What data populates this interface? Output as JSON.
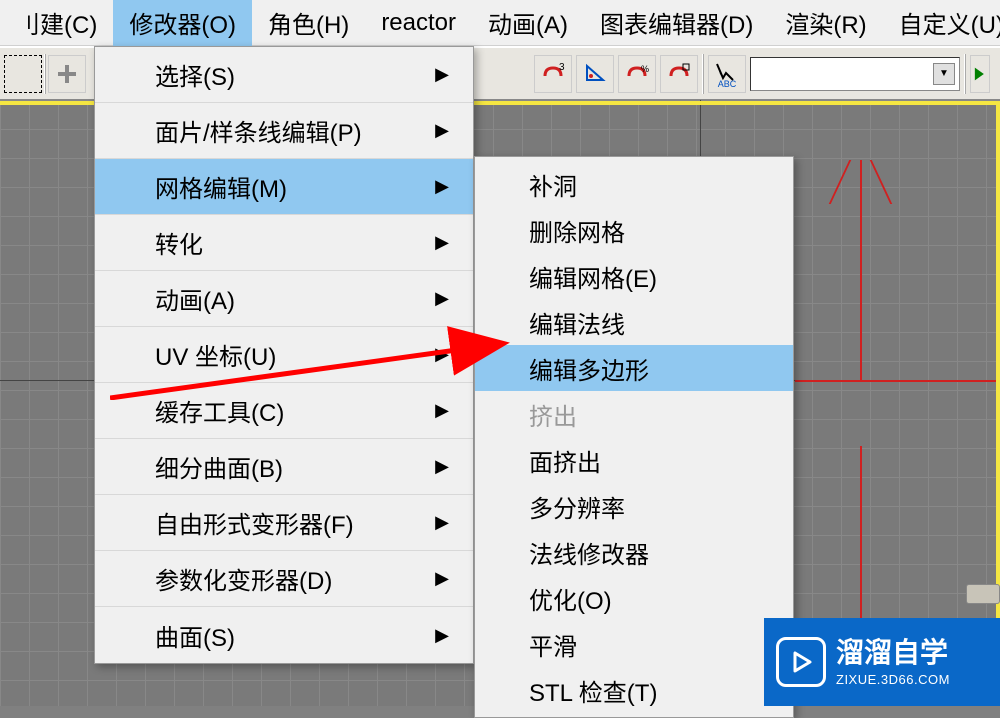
{
  "menubar": {
    "items": [
      {
        "label": "刂建(C)"
      },
      {
        "label": "修改器(O)",
        "active": true
      },
      {
        "label": "角色(H)"
      },
      {
        "label": "reactor"
      },
      {
        "label": "动画(A)"
      },
      {
        "label": "图表编辑器(D)"
      },
      {
        "label": "渲染(R)"
      },
      {
        "label": "自定义(U)"
      }
    ]
  },
  "dropdown": {
    "items": [
      {
        "label": "选择(S)"
      },
      {
        "label": "面片/样条线编辑(P)"
      },
      {
        "label": "网格编辑(M)",
        "active": true
      },
      {
        "label": "转化"
      },
      {
        "label": "动画(A)"
      },
      {
        "label": "UV 坐标(U)"
      },
      {
        "label": "缓存工具(C)"
      },
      {
        "label": "细分曲面(B)"
      },
      {
        "label": "自由形式变形器(F)"
      },
      {
        "label": "参数化变形器(D)"
      },
      {
        "label": "曲面(S)"
      }
    ]
  },
  "submenu": {
    "items": [
      {
        "label": "补洞"
      },
      {
        "label": "删除网格"
      },
      {
        "label": "编辑网格(E)"
      },
      {
        "label": "编辑法线"
      },
      {
        "label": "编辑多边形",
        "active": true
      },
      {
        "label": "挤出",
        "disabled": true
      },
      {
        "label": "面挤出"
      },
      {
        "label": "多分辨率"
      },
      {
        "label": "法线修改器"
      },
      {
        "label": "优化(O)"
      },
      {
        "label": "平滑"
      },
      {
        "label": "STL 检查(T)"
      }
    ]
  },
  "watermark": {
    "title": "溜溜自学",
    "url": "ZIXUE.3D66.COM"
  },
  "icons": {
    "abc": "ABC"
  }
}
